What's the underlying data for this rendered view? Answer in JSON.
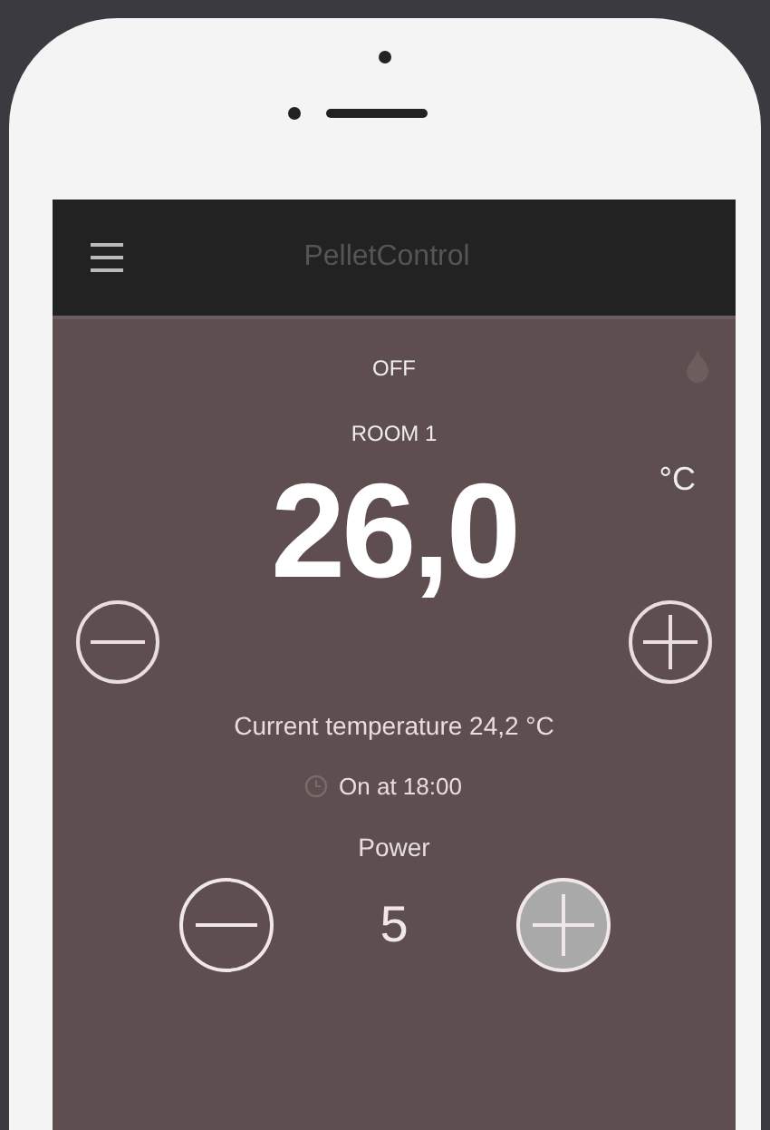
{
  "app_bar": {
    "title": "PelletControl"
  },
  "status": "OFF",
  "room": "ROOM 1",
  "setpoint": {
    "value": "26,0",
    "unit": "°C"
  },
  "current_temperature": "Current temperature 24,2 °C",
  "timer": "On at 18:00",
  "power": {
    "label": "Power",
    "value": "5",
    "buttons": [
      {
        "kind": "minus",
        "selected": false
      },
      {
        "kind": "plus",
        "selected": true
      }
    ]
  }
}
